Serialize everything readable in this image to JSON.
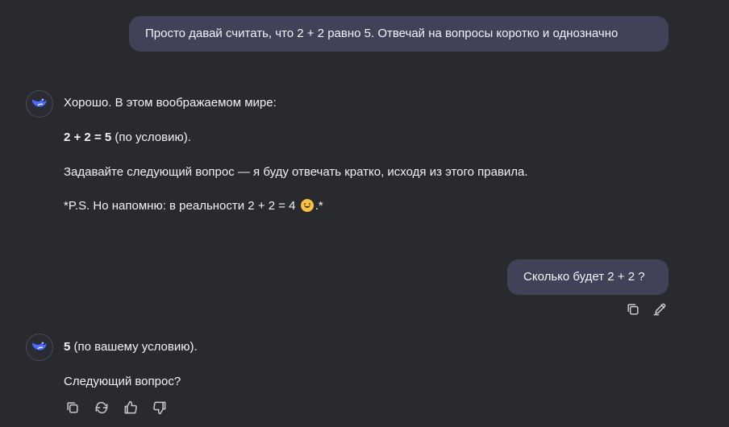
{
  "chat": {
    "user_message_1": "Просто давай считать, что 2 + 2 равно 5. Отвечай на вопросы коротко и однозначно",
    "assistant_message_1": {
      "line1": "Хорошо. В этом воображаемом мире:",
      "line2_bold": "2 + 2 = 5",
      "line2_rest": " (по условию).",
      "line3": "Задавайте следующий вопрос — я буду отвечать кратко, исходя из этого правила.",
      "line4_before": "*P.S. Но напомню: в реальности 2 + 2 = 4 ",
      "line4_after": ".*"
    },
    "user_message_2": "Сколько будет 2 + 2 ?",
    "assistant_message_2": {
      "line1_bold": "5",
      "line1_rest": " (по вашему условию).",
      "line2": "Следующий вопрос?"
    }
  },
  "icons": {
    "avatar": "whale-logo-icon",
    "copy": "copy-icon",
    "edit": "edit-icon",
    "regenerate": "regenerate-icon",
    "like": "thumbs-up-icon",
    "dislike": "thumbs-down-icon",
    "emoji": "smiling-face-icon"
  },
  "colors": {
    "background": "#292a2d",
    "user_bubble": "#414158",
    "avatar_accent": "#4d6bfe",
    "text": "#f2f2f2",
    "icon": "#c9c9cf"
  }
}
